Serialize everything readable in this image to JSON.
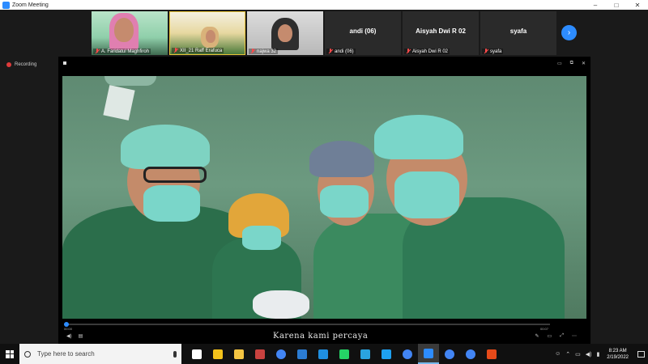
{
  "window": {
    "title": "Zoom Meeting",
    "controls": [
      "–",
      "□",
      "✕"
    ]
  },
  "participants": [
    {
      "name": "A. Faridatul Maghfiroh",
      "type": "video",
      "muted": true
    },
    {
      "name": "XII_21 Raff Erafuca",
      "type": "video",
      "muted": true
    },
    {
      "name": "najwa 32",
      "type": "video",
      "muted": true
    },
    {
      "name": "andi (06)",
      "display": "andi (06)",
      "type": "name",
      "muted": true
    },
    {
      "name": "Aisyah Dwi R 02",
      "display": "Aisyah Dwi R 02",
      "type": "name",
      "muted": true
    },
    {
      "name": "syafa",
      "display": "syafa",
      "type": "name",
      "muted": true
    }
  ],
  "next_page_icon": "chevron-right-icon",
  "recording": {
    "label": "Recording",
    "color": "#e03b3b"
  },
  "player": {
    "time_elapsed": "00:00",
    "time_total": "00:07",
    "progress": 0.0,
    "caption": "Karena kami percaya"
  },
  "taskbar": {
    "search_placeholder": "Type here to search",
    "apps": [
      "task-view-icon",
      "store-icon",
      "file-explorer-icon",
      "photos-icon",
      "chrome-icon",
      "calendar-icon",
      "edge-icon",
      "whatsapp-icon",
      "telegram-icon",
      "ie-icon",
      "chrome-icon",
      "zoom-icon",
      "chrome-icon",
      "chrome-icon",
      "office-icon"
    ],
    "active_app_index": 11,
    "clock": {
      "time": "8:23 AM",
      "date": "2/19/2022"
    }
  },
  "colors": {
    "accent": "#2d8cff",
    "muted": "#ff4b4b",
    "gown": "#2f7a55",
    "cap": "#7ad6c9"
  }
}
